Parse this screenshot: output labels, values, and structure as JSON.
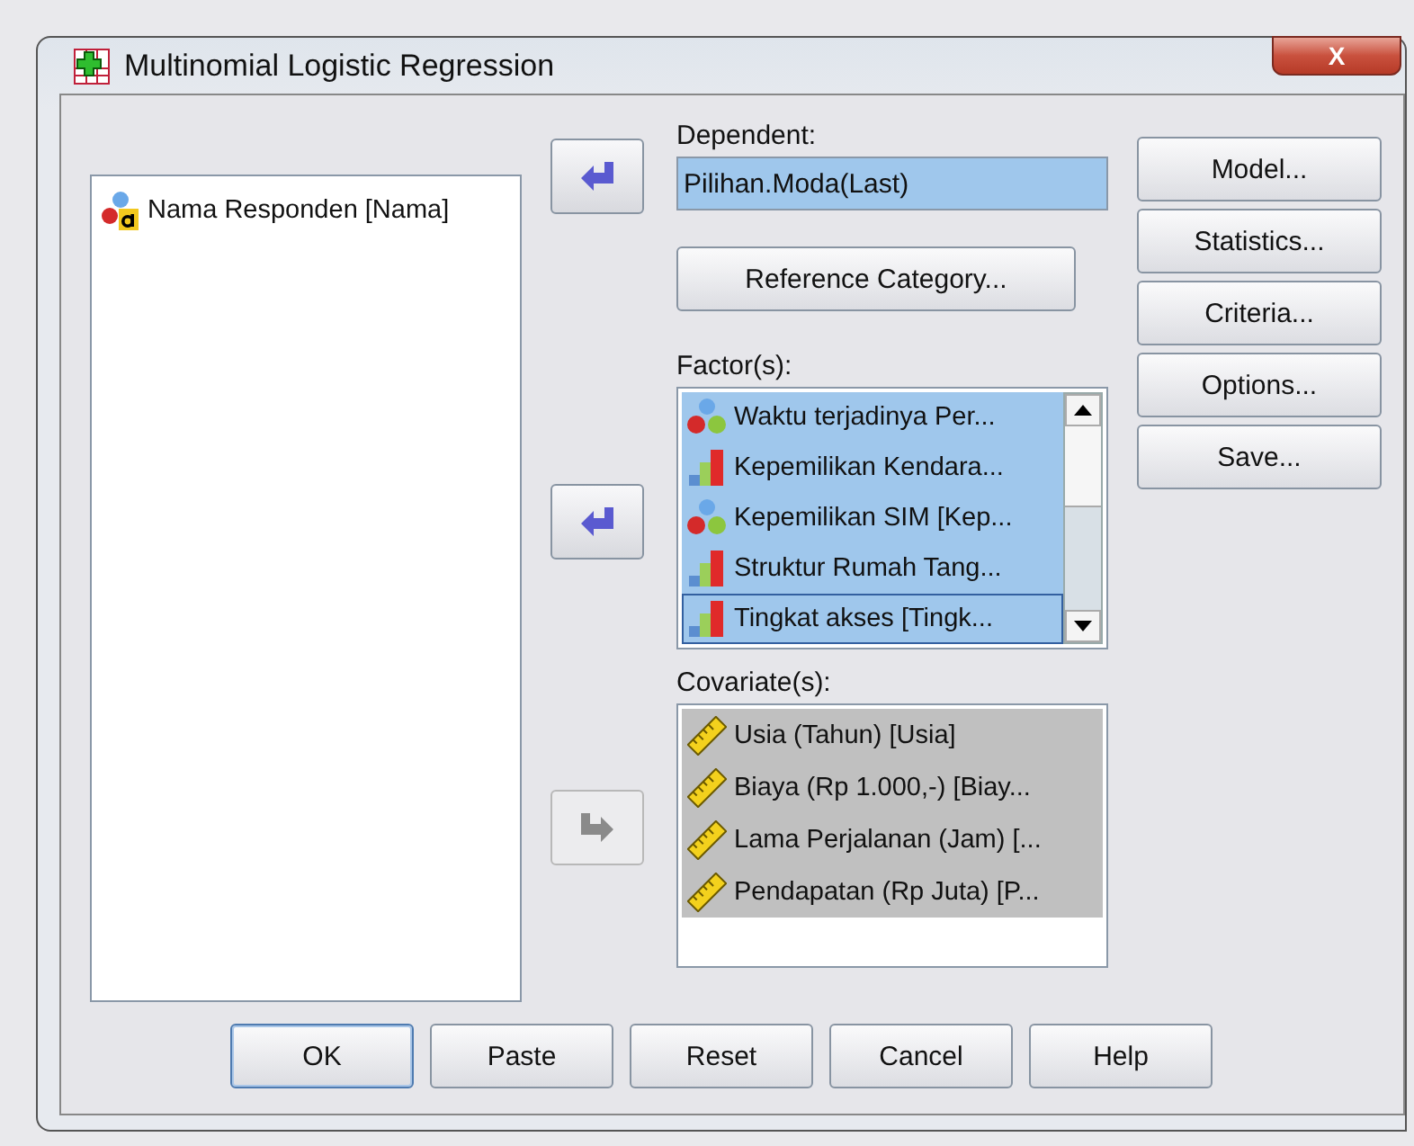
{
  "window": {
    "title": "Multinomial Logistic Regression",
    "close_button": "X"
  },
  "source_list": {
    "items": [
      {
        "label": "Nama Responden [Nama]",
        "kind": "string",
        "selected": false
      }
    ]
  },
  "move_buttons": [
    {
      "kind": "left",
      "disabled": false
    },
    {
      "kind": "left",
      "disabled": false
    },
    {
      "kind": "right",
      "disabled": true
    }
  ],
  "dependent": {
    "label": "Dependent:",
    "value": "Pilihan.Moda(Last)"
  },
  "reference_category_button": "Reference Category...",
  "factors": {
    "label": "Factor(s):",
    "items": [
      {
        "label": "Waktu terjadinya Per...",
        "kind": "nominal",
        "selected": true,
        "focused": false
      },
      {
        "label": "Kepemilikan Kendara...",
        "kind": "ordinal",
        "selected": true,
        "focused": false
      },
      {
        "label": "Kepemilikan SIM [Kep...",
        "kind": "nominal",
        "selected": true,
        "focused": false
      },
      {
        "label": "Struktur Rumah Tang...",
        "kind": "ordinal",
        "selected": true,
        "focused": false
      },
      {
        "label": "Tingkat akses [Tingk...",
        "kind": "ordinal",
        "selected": true,
        "focused": true
      }
    ]
  },
  "covariates": {
    "label": "Covariate(s):",
    "items": [
      {
        "label": "Usia (Tahun) [Usia]",
        "kind": "scale",
        "selected": true
      },
      {
        "label": "Biaya (Rp 1.000,-) [Biay...",
        "kind": "scale",
        "selected": true
      },
      {
        "label": "Lama Perjalanan (Jam) [...",
        "kind": "scale",
        "selected": true
      },
      {
        "label": "Pendapatan (Rp Juta) [P...",
        "kind": "scale",
        "selected": true
      }
    ]
  },
  "side_buttons": [
    "Model...",
    "Statistics...",
    "Criteria...",
    "Options...",
    "Save..."
  ],
  "bottom_buttons": [
    {
      "label": "OK",
      "default": true
    },
    {
      "label": "Paste",
      "default": false
    },
    {
      "label": "Reset",
      "default": false
    },
    {
      "label": "Cancel",
      "default": false
    },
    {
      "label": "Help",
      "default": false
    }
  ]
}
